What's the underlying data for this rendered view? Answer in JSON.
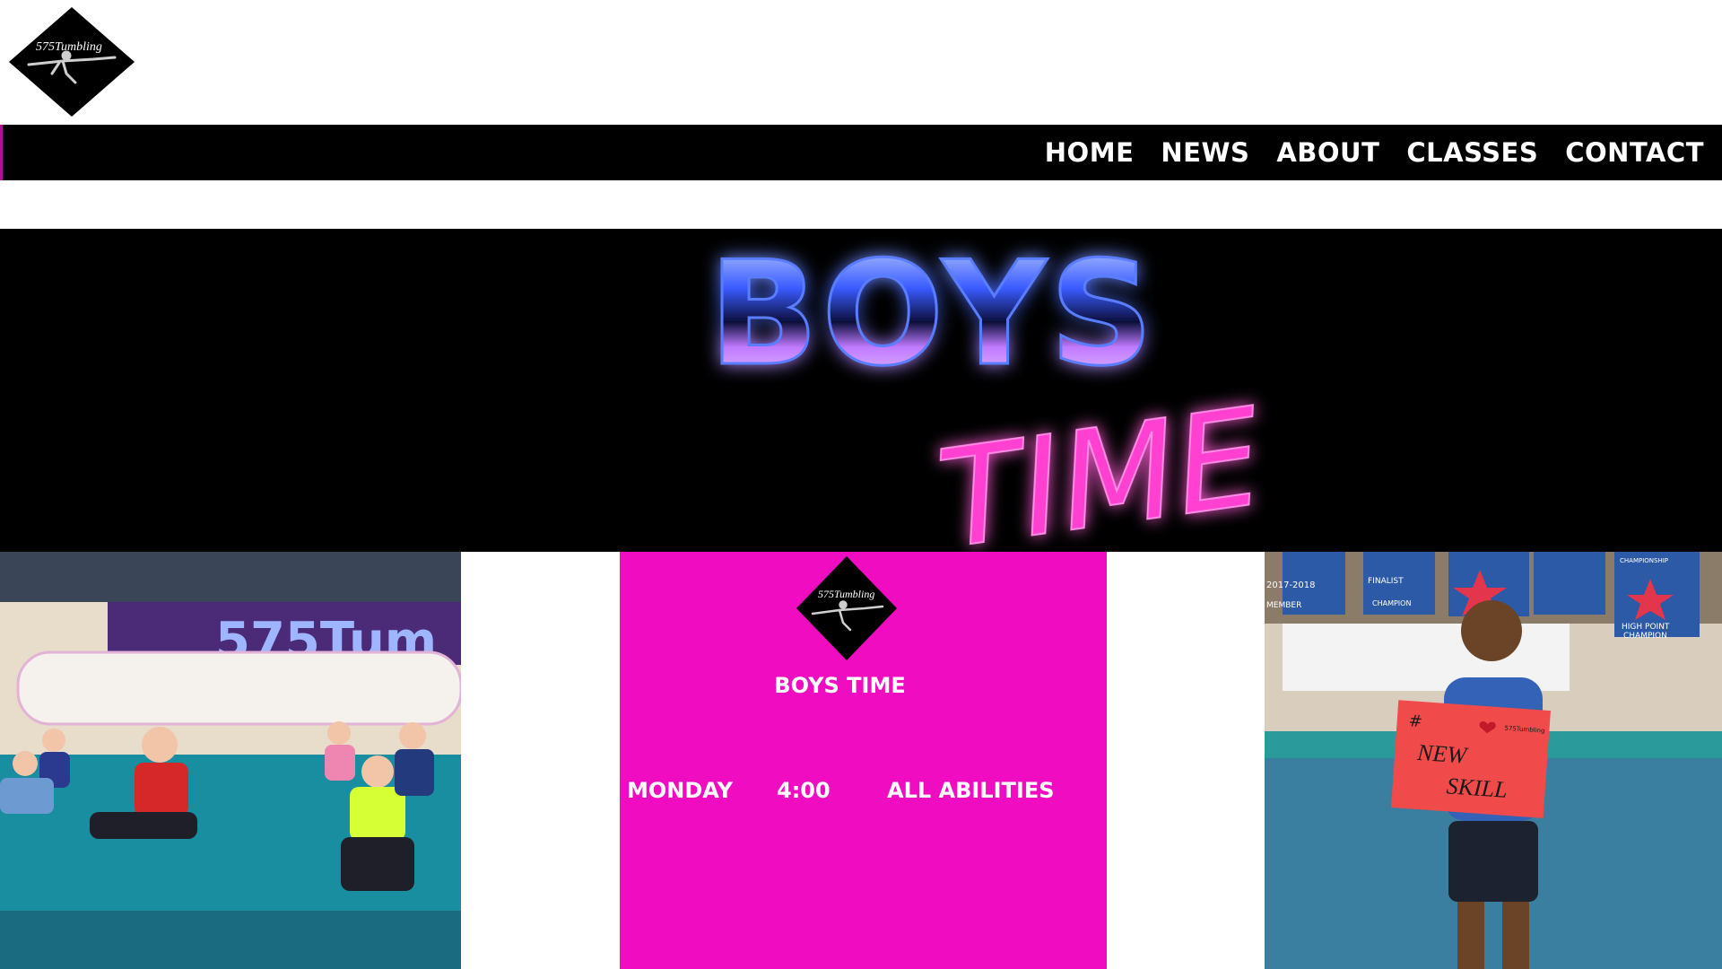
{
  "brand": {
    "logo_text": "575Tumbling",
    "logo_icon": "gymnast-diamond-logo"
  },
  "nav": {
    "items": [
      {
        "label": "HOME"
      },
      {
        "label": "NEWS"
      },
      {
        "label": "ABOUT"
      },
      {
        "label": "CLASSES"
      },
      {
        "label": "CONTACT"
      }
    ]
  },
  "hero": {
    "title_line1": "BOYS",
    "title_line2": "TIME"
  },
  "class_card": {
    "logo_text": "575Tumbling",
    "title": "BOYS TIME",
    "day": "MONDAY",
    "time": "4:00",
    "level": "ALL ABILITIES",
    "background_color": "#f00cc0"
  },
  "photos": {
    "left_wall_text": "575Tum",
    "right_sign_hash": "#",
    "right_sign_line1": "NEW",
    "right_sign_line2": "SKILL",
    "right_sign_small": "575Tumbling",
    "right_banner_1": "2017-2018",
    "right_banner_2": "FINALIST",
    "right_banner_3": "CHAMPION",
    "right_banner_4": "CHAMPIONSHIP",
    "right_banner_5": "HIGH POINT",
    "right_banner_6": "CHAMPION",
    "right_banner_7": "MEMBER"
  },
  "colors": {
    "accent_pink": "#f00cc0",
    "nav_bg": "#000000",
    "nav_text": "#ffffff"
  }
}
